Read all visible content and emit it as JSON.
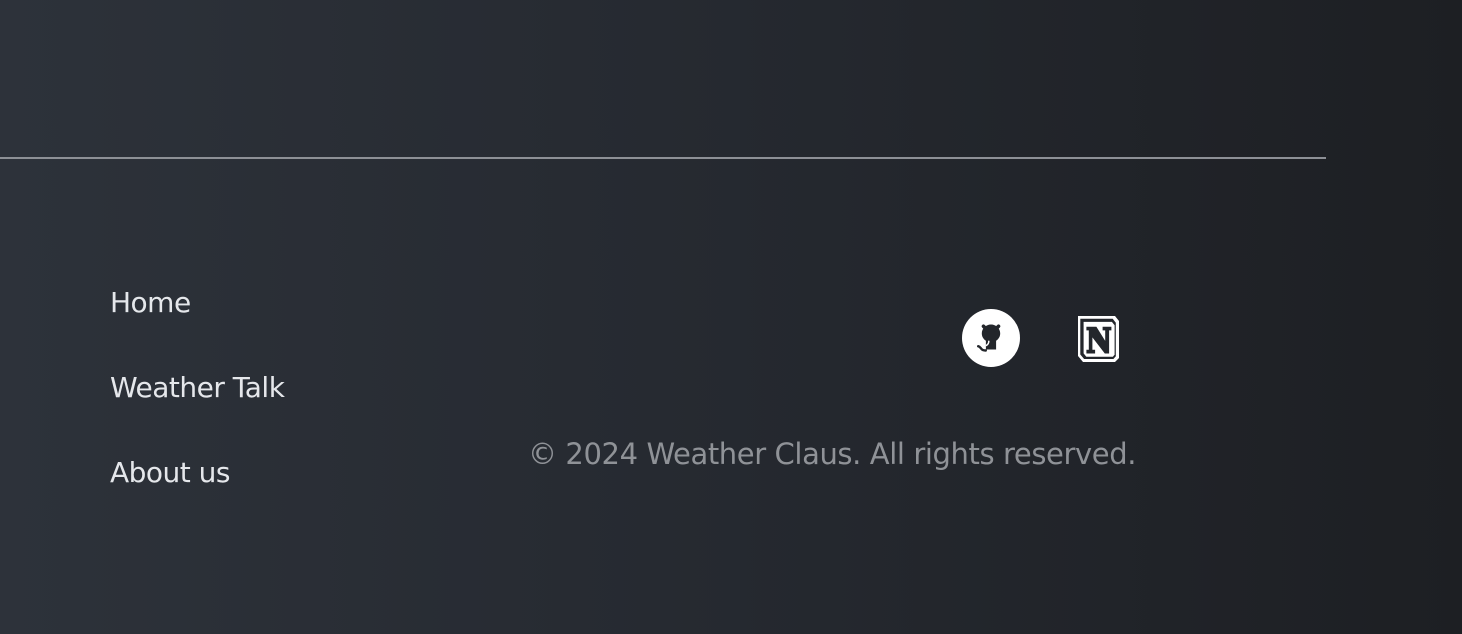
{
  "footer": {
    "nav": {
      "items": [
        {
          "label": "Home"
        },
        {
          "label": "Weather Talk"
        },
        {
          "label": "About us"
        }
      ]
    },
    "social": [
      {
        "icon": "github-icon"
      },
      {
        "icon": "notion-icon"
      }
    ],
    "copyright": "© 2024 Weather Claus. All rights reserved."
  },
  "colors": {
    "background_left": "#2d323a",
    "background_right": "#1d1f23",
    "divider": "#8d9096",
    "nav_text": "#e5e7eb",
    "copyright_text": "#8f9297",
    "icon": "#ffffff"
  }
}
